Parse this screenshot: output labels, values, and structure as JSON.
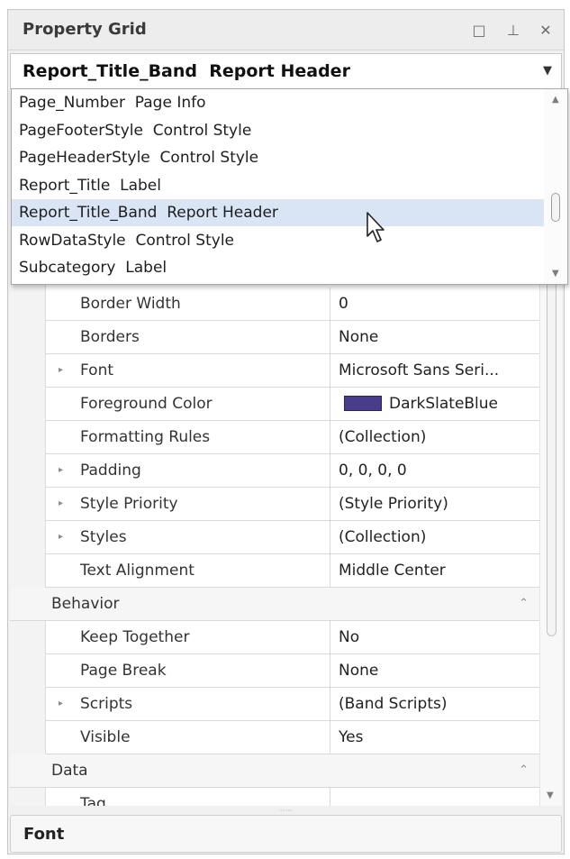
{
  "window": {
    "title": "Property Grid",
    "buttons": {
      "float_icon": "restore-icon",
      "pin_icon": "pin-icon",
      "close_icon": "close-icon"
    }
  },
  "selector": {
    "value": "Report_Title_Band  Report Header"
  },
  "dropdown": {
    "items": [
      {
        "label": "Page_Number  Page Info"
      },
      {
        "label": "PageFooterStyle  Control Style"
      },
      {
        "label": "PageHeaderStyle  Control Style"
      },
      {
        "label": "Report_Title  Label"
      },
      {
        "label": "Report_Title_Band  Report Header",
        "selected": true
      },
      {
        "label": "RowDataStyle  Control Style"
      },
      {
        "label": "Subcategory  Label"
      }
    ]
  },
  "grid": {
    "rows": [
      {
        "kind": "prop",
        "name": "Border Width",
        "value": "0"
      },
      {
        "kind": "prop",
        "name": "Borders",
        "value": "None"
      },
      {
        "kind": "prop",
        "name": "Font",
        "value": "Microsoft Sans Seri...",
        "expandable": true
      },
      {
        "kind": "prop",
        "name": "Foreground Color",
        "value": "DarkSlateBlue",
        "color": "#483D8B"
      },
      {
        "kind": "prop",
        "name": "Formatting Rules",
        "value": "(Collection)"
      },
      {
        "kind": "prop",
        "name": "Padding",
        "value": "0, 0, 0, 0",
        "expandable": true
      },
      {
        "kind": "prop",
        "name": "Style Priority",
        "value": "(Style Priority)",
        "expandable": true
      },
      {
        "kind": "prop",
        "name": "Styles",
        "value": "(Collection)",
        "expandable": true
      },
      {
        "kind": "prop",
        "name": "Text Alignment",
        "value": "Middle Center"
      },
      {
        "kind": "category",
        "name": "Behavior"
      },
      {
        "kind": "prop",
        "name": "Keep Together",
        "value": "No"
      },
      {
        "kind": "prop",
        "name": "Page Break",
        "value": "None"
      },
      {
        "kind": "prop",
        "name": "Scripts",
        "value": "(Band Scripts)",
        "expandable": true
      },
      {
        "kind": "prop",
        "name": "Visible",
        "value": "Yes"
      },
      {
        "kind": "category",
        "name": "Data"
      },
      {
        "kind": "prop",
        "name": "Tag",
        "value": ""
      }
    ]
  },
  "description": {
    "title": "Font"
  }
}
